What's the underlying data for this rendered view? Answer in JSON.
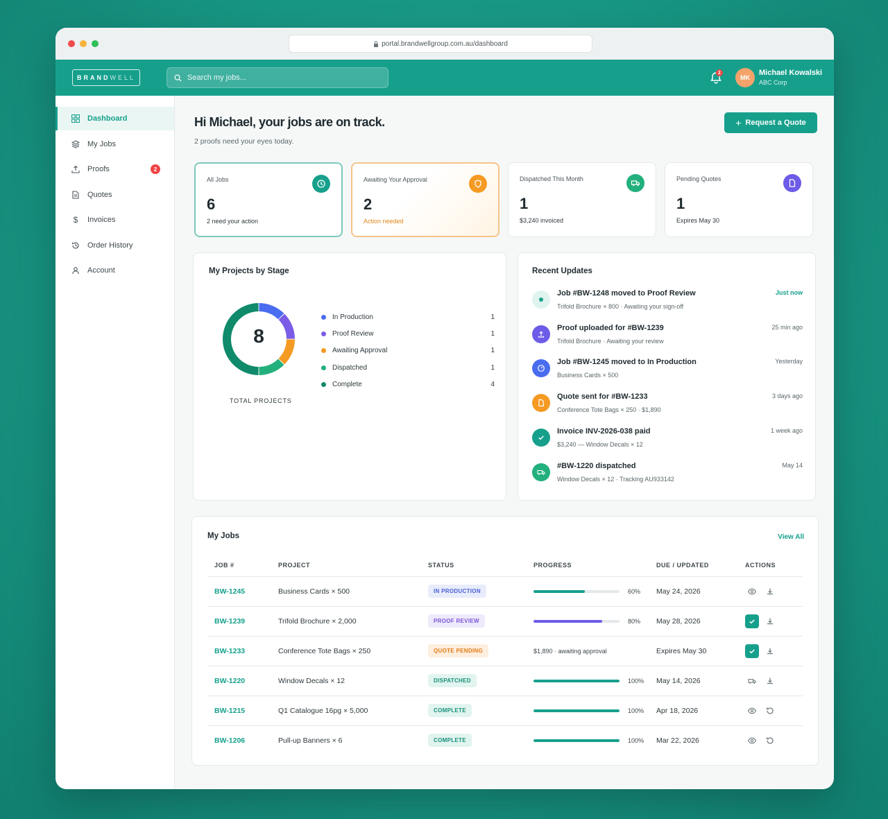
{
  "browser": {
    "url": "portal.brandwellgroup.com.au/dashboard"
  },
  "header": {
    "logo_primary": "BRAND",
    "logo_secondary": "WELL",
    "search_placeholder": "Search my jobs...",
    "notifications_count": "2",
    "user_initials": "MK",
    "user_name": "Michael Kowalski",
    "user_company": "ABC Corp"
  },
  "sidebar": {
    "items": [
      {
        "label": "Dashboard",
        "icon": "grid-icon",
        "active": true
      },
      {
        "label": "My Jobs",
        "icon": "layers-icon"
      },
      {
        "label": "Proofs",
        "icon": "upload-icon",
        "badge": "2"
      },
      {
        "label": "Quotes",
        "icon": "document-icon"
      },
      {
        "label": "Invoices",
        "icon": "dollar-icon"
      },
      {
        "label": "Order History",
        "icon": "history-icon"
      },
      {
        "label": "Account",
        "icon": "user-icon"
      }
    ]
  },
  "page": {
    "greeting": "Hi Michael, your jobs are on track.",
    "subtitle": "2 proofs need your eyes today.",
    "request_quote_label": "Request a Quote"
  },
  "stats": [
    {
      "label": "All Jobs",
      "value": "6",
      "note": "2 need your action",
      "icon": "clock-icon",
      "color": "#16a08c"
    },
    {
      "label": "Awaiting Your Approval",
      "value": "2",
      "note": "Action needed",
      "icon": "shield-icon",
      "color": "#f59a23"
    },
    {
      "label": "Dispatched This Month",
      "value": "1",
      "note": "$3,240 invoiced",
      "icon": "truck-icon",
      "color": "#22b07d"
    },
    {
      "label": "Pending Quotes",
      "value": "1",
      "note": "Expires May 30",
      "icon": "file-icon",
      "color": "#6c5ce7"
    }
  ],
  "projects_panel": {
    "title": "My Projects by Stage",
    "total": "8",
    "total_label": "TOTAL PROJECTS"
  },
  "chart_data": {
    "type": "pie",
    "title": "My Projects by Stage",
    "categories": [
      "In Production",
      "Proof Review",
      "Awaiting Approval",
      "Dispatched",
      "Complete"
    ],
    "values": [
      1,
      1,
      1,
      1,
      4
    ],
    "colors": [
      "#4a6cf0",
      "#7b5ce6",
      "#f59a23",
      "#22b07d",
      "#0f8a6a"
    ],
    "total": 8
  },
  "updates_panel": {
    "title": "Recent Updates",
    "items": [
      {
        "title": "Job #BW-1248 moved to Proof Review",
        "sub": "Trifold Brochure × 800 · Awaiting your sign-off",
        "time": "Just now",
        "icon": "dot-icon",
        "color": "#16a08c",
        "bg": "#dff3ef"
      },
      {
        "title": "Proof uploaded for #BW-1239",
        "sub": "Trifold Brochure · Awaiting your review",
        "time": "25 min ago",
        "icon": "upload-icon",
        "color": "#ffffff",
        "bg": "#6c5ce7"
      },
      {
        "title": "Job #BW-1245 moved to In Production",
        "sub": "Business Cards × 500",
        "time": "Yesterday",
        "icon": "gauge-icon",
        "color": "#ffffff",
        "bg": "#4a6cf0"
      },
      {
        "title": "Quote sent for #BW-1233",
        "sub": "Conference Tote Bags × 250 · $1,890",
        "time": "3 days ago",
        "icon": "file-icon",
        "color": "#ffffff",
        "bg": "#f59a23"
      },
      {
        "title": "Invoice INV-2026-038 paid",
        "sub": "$3,240 — Window Decals × 12",
        "time": "1 week ago",
        "icon": "check-icon",
        "color": "#ffffff",
        "bg": "#16a08c"
      },
      {
        "title": "#BW-1220 dispatched",
        "sub": "Window Decals × 12 · Tracking AU933142",
        "time": "May 14",
        "icon": "truck-icon",
        "color": "#ffffff",
        "bg": "#22b07d"
      }
    ]
  },
  "jobs_panel": {
    "title": "My Jobs",
    "view_all": "View All",
    "columns": [
      "JOB #",
      "PROJECT",
      "STATUS",
      "PROGRESS",
      "DUE / UPDATED",
      "ACTIONS"
    ],
    "rows": [
      {
        "id": "BW-1245",
        "project": "Business Cards × 500",
        "status": "IN PRODUCTION",
        "status_class": "prod",
        "progress": 60,
        "progress_label": "60%",
        "bar_color": "#16a08c",
        "due": "May 24, 2026",
        "actions": [
          "eye-icon",
          "download-icon"
        ]
      },
      {
        "id": "BW-1239",
        "project": "Trifold Brochure × 2,000",
        "status": "PROOF REVIEW",
        "status_class": "proof",
        "progress": 80,
        "progress_label": "80%",
        "bar_color": "#6c5ce7",
        "due": "May 28, 2026",
        "actions": [
          "approve-icon",
          "download-icon"
        ]
      },
      {
        "id": "BW-1233",
        "project": "Conference Tote Bags × 250",
        "status": "QUOTE PENDING",
        "status_class": "quote",
        "progress_text": "$1,890 · awaiting approval",
        "due": "Expires May 30",
        "actions": [
          "approve-icon",
          "download-icon"
        ]
      },
      {
        "id": "BW-1220",
        "project": "Window Decals × 12",
        "status": "DISPATCHED",
        "status_class": "disp",
        "progress": 100,
        "progress_label": "100%",
        "bar_color": "#16a08c",
        "due": "May 14, 2026",
        "actions": [
          "truck-icon",
          "download-icon"
        ]
      },
      {
        "id": "BW-1215",
        "project": "Q1 Catalogue 16pg × 5,000",
        "status": "COMPLETE",
        "status_class": "comp",
        "progress": 100,
        "progress_label": "100%",
        "bar_color": "#16a08c",
        "due": "Apr 18, 2026",
        "actions": [
          "eye-icon",
          "reorder-icon"
        ]
      },
      {
        "id": "BW-1206",
        "project": "Pull-up Banners × 6",
        "status": "COMPLETE",
        "status_class": "comp",
        "progress": 100,
        "progress_label": "100%",
        "bar_color": "#16a08c",
        "due": "Mar 22, 2026",
        "actions": [
          "eye-icon",
          "reorder-icon"
        ]
      }
    ]
  }
}
